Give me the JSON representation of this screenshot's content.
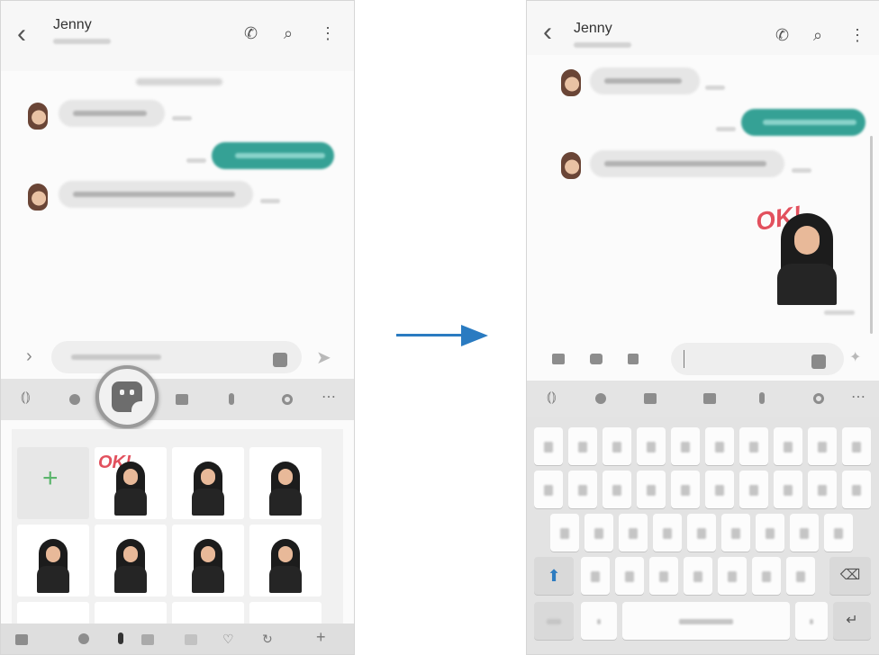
{
  "contact_name": "Jenny",
  "left_screen": {
    "panel": {
      "ok_text": "OK!"
    }
  },
  "right_screen": {
    "sticker_ok": "OK!"
  },
  "icons": {
    "back": "chevron-left-icon",
    "call": "phone-icon",
    "search": "search-icon",
    "menu": "more-vert-icon"
  },
  "colors": {
    "accent_bubble": "#35a195",
    "arrow": "#2a7bc1",
    "ok_text": "#e2515e",
    "add_plus": "#5bb56c"
  }
}
